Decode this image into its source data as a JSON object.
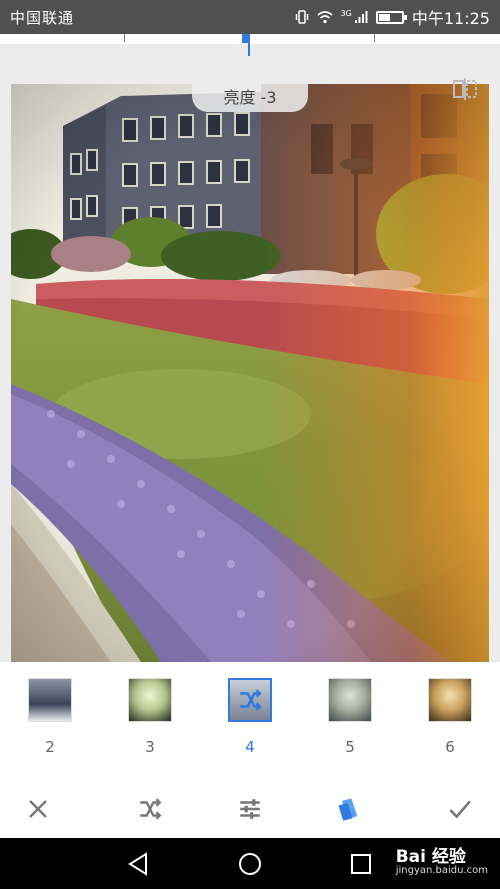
{
  "status_bar": {
    "carrier": "中国联通",
    "network": "3G",
    "time": "中午11:25"
  },
  "adjust": {
    "value_label": "亮度 -3",
    "brightness": -3
  },
  "filters": [
    {
      "number": "2",
      "selected": false
    },
    {
      "number": "3",
      "selected": false
    },
    {
      "number": "4",
      "selected": true
    },
    {
      "number": "5",
      "selected": false
    },
    {
      "number": "6",
      "selected": false
    }
  ],
  "toolbar": {
    "icons": [
      "close-icon",
      "shuffle-icon",
      "tune-icon",
      "style-icon",
      "check-icon"
    ]
  },
  "nav": {
    "icons": [
      "back-icon",
      "home-icon",
      "recents-icon"
    ]
  },
  "watermark": {
    "brand": "Bai 经验",
    "url": "jingyan.baidu.com"
  },
  "colors": {
    "accent": "#2f7be0",
    "status_bar": "#505050",
    "nav_bar": "#000000"
  }
}
